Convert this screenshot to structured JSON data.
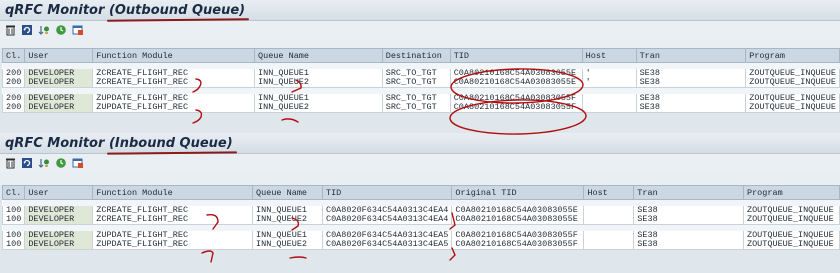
{
  "outbound": {
    "title_prefix": "qRFC Monitor ",
    "title_underlined": "(Outbound Queue)",
    "toolbar_icons": [
      "trash-icon",
      "refresh-icon",
      "sort-icon",
      "schedule-icon",
      "filter-icon"
    ],
    "headers": [
      "Cl.",
      "User",
      "Function Module",
      "Queue Name",
      "Destination",
      "TID",
      "Host",
      "Tran",
      "Program"
    ],
    "groups": [
      [
        [
          "200",
          "DEVELOPER",
          "ZCREATE_FLIGHT_REC",
          "INN_QUEUE1",
          "SRC_TO_TGT",
          "C0A80210168C54A03083055E",
          "'",
          "SE38",
          "ZOUTQUEUE_INQUEUE"
        ],
        [
          "200",
          "DEVELOPER",
          "ZCREATE_FLIGHT_REC",
          "INN_QUEUE2",
          "SRC_TO_TGT",
          "C0A80210168C54A03083055E",
          "'",
          "SE38",
          "ZOUTQUEUE_INQUEUE"
        ]
      ],
      [
        [
          "200",
          "DEVELOPER",
          "ZUPDATE_FLIGHT_REC",
          "INN_QUEUE1",
          "SRC_TO_TGT",
          "C0A80210168C54A03083055F",
          "",
          "SE38",
          "ZOUTQUEUE_INQUEUE"
        ],
        [
          "200",
          "DEVELOPER",
          "ZUPDATE_FLIGHT_REC",
          "INN_QUEUE2",
          "SRC_TO_TGT",
          "C0A80210168C54A03083055F",
          "",
          "SE38",
          "ZOUTQUEUE_INQUEUE"
        ]
      ]
    ]
  },
  "inbound": {
    "title_prefix": "qRFC Monitor ",
    "title_underlined": "(Inbound Queue)",
    "toolbar_icons": [
      "trash-icon",
      "refresh-icon",
      "sort-icon",
      "schedule-icon",
      "filter-icon"
    ],
    "headers": [
      "Cl.",
      "User",
      "Function Module",
      "Queue Name",
      "TID",
      "Original TID",
      "Host",
      "Tran",
      "Program"
    ],
    "groups": [
      [
        [
          "100",
          "DEVELOPER",
          "ZCREATE_FLIGHT_REC",
          "INN_QUEUE1",
          "C0A8020F634C54A0313C4EA4",
          "C0A80210168C54A03083055E",
          "",
          "SE38",
          "ZOUTQUEUE_INQUEUE"
        ],
        [
          "100",
          "DEVELOPER",
          "ZCREATE_FLIGHT_REC",
          "INN_QUEUE2",
          "C0A8020F634C54A0313C4EA4",
          "C0A80210168C54A03083055E",
          "",
          "SE38",
          "ZOUTQUEUE_INQUEUE"
        ]
      ],
      [
        [
          "100",
          "DEVELOPER",
          "ZUPDATE_FLIGHT_REC",
          "INN_QUEUE1",
          "C0A8020F634C54A0313C4EA5",
          "C0A80210168C54A03083055F",
          "",
          "SE38",
          "ZOUTQUEUE_INQUEUE"
        ],
        [
          "100",
          "DEVELOPER",
          "ZUPDATE_FLIGHT_REC",
          "INN_QUEUE2",
          "C0A8020F634C54A0313C4EA5",
          "C0A80210168C54A03083055F",
          "",
          "SE38",
          "ZOUTQUEUE_INQUEUE"
        ]
      ]
    ]
  },
  "colors": {
    "annotation": "#b00f0f",
    "header_bg": "#cbd7e2",
    "title": "#1a2b44"
  }
}
